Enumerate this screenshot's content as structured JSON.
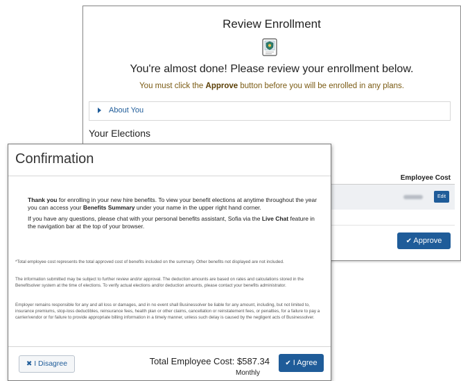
{
  "review": {
    "title": "Review Enrollment",
    "heading": "You're almost done! Please review your enrollment below.",
    "must_prefix": "You must click the ",
    "must_bold": "Approve",
    "must_suffix": " button before you will be enrolled in any plans.",
    "about_label": "About You",
    "elections_title": "Your Elections",
    "employee_cost_header": "Employee Cost",
    "edit_label": "Edit",
    "approve_label": "Approve",
    "approve_check": "✔"
  },
  "confirmation": {
    "title": "Confirmation",
    "p1_bold1": "Thank you",
    "p1_text1": " for enrolling in your new hire benefits. To view your benefit elections at anytime throughout the year you can access your ",
    "p1_bold2": "Benefits Summary",
    "p1_text2": " under your name in the upper right hand corner.",
    "p2_text1": "If you have any questions, please chat with your personal benefits assistant, Sofia via the ",
    "p2_bold": "Live Chat",
    "p2_text2": " feature in the navigation bar at the top of your browser.",
    "foot1": "*Total employee cost represents the total approved cost of benefits included on the summary. Other benefits not displayed are not included.",
    "foot2": "The information submitted may be subject to further review and/or approval. The deduction amounts are based on rates and calculations stored in the Benefitsolver system at the time of elections. To verify actual elections and/or deduction amounts, please contact your benefits administrator.",
    "foot3": "Employer remains responsible for any and all loss or damages, and in no event shall Businessolver be liable for any amount, including, but not limited to, insurance premiums, stop-loss deductibles, reinsurance fees, health plan or other claims, cancellation or reinstatement fees, or penalties, for a failure to pay a carrier/vendor or for failure to provide appropriate billing information in a timely manner, unless such delay is caused by the negligent acts of Businessolver.",
    "disagree_icon": "✖",
    "disagree_label": "I Disagree",
    "total_label": "Total Employee Cost: $587.34",
    "monthly_label": "Monthly",
    "agree_check": "✔",
    "agree_label": "I Agree"
  },
  "colors": {
    "primary": "#1f5c99",
    "notice": "#7a5a12"
  }
}
